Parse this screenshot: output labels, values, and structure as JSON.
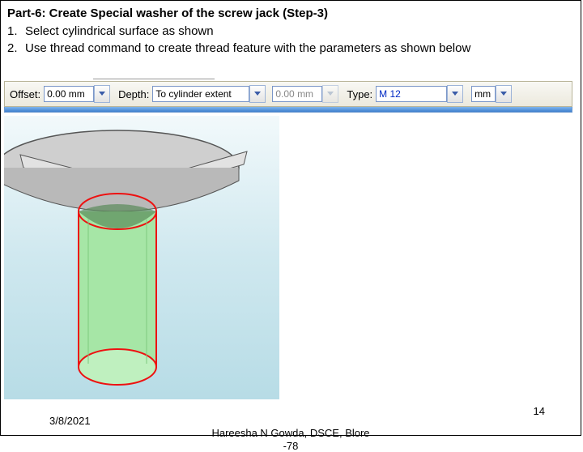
{
  "heading": "Part-6: Create Special washer of the screw jack (Step-3)",
  "steps": [
    {
      "num": "1.",
      "text": "Select cylindrical surface as shown"
    },
    {
      "num": "2.",
      "text": "Use thread command to create thread feature with the parameters as shown below"
    }
  ],
  "toolbar": {
    "offset_label": "Offset:",
    "offset_value": "0.00 mm",
    "depth_label": "Depth:",
    "depth_value": "To cylinder extent",
    "second_offset_value": "0.00 mm",
    "type_label": "Type:",
    "type_value": "M 12",
    "unit_value": "mm"
  },
  "footer": {
    "date": "3/8/2021",
    "center_line1": "Hareesha N Gowda, DSCE, Blore",
    "center_line2": "-78",
    "page": "14"
  }
}
